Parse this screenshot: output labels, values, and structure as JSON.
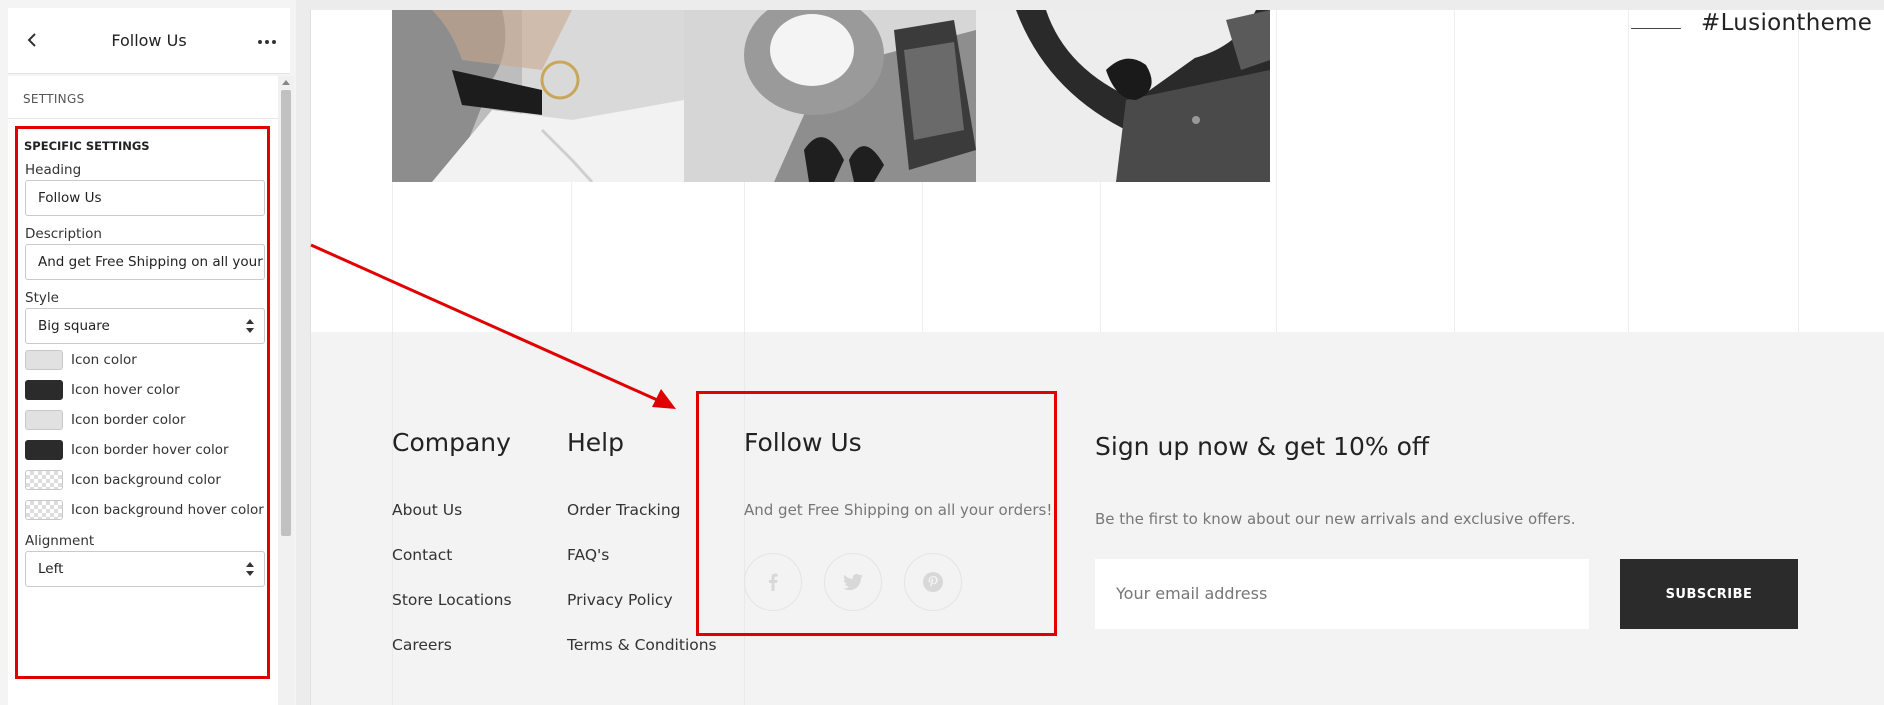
{
  "sidebar": {
    "title": "Follow Us",
    "section_label": "SETTINGS",
    "specific_settings_title": "SPECIFIC SETTINGS",
    "heading": {
      "label": "Heading",
      "value": "Follow Us"
    },
    "description": {
      "label": "Description",
      "value": "And get Free Shipping on all your orders!"
    },
    "style": {
      "label": "Style",
      "selected": "Big square"
    },
    "swatches": [
      {
        "label": "Icon color",
        "color": "#e1e1e1"
      },
      {
        "label": "Icon hover color",
        "color": "#2b2b2b"
      },
      {
        "label": "Icon border color",
        "color": "#e1e1e1"
      },
      {
        "label": "Icon border hover color",
        "color": "#2b2b2b"
      },
      {
        "label": "Icon background color",
        "color": "transparent"
      },
      {
        "label": "Icon background hover color",
        "color": "transparent"
      }
    ],
    "alignment": {
      "label": "Alignment",
      "selected": "Left"
    }
  },
  "preview": {
    "hashtag": "#Lusiontheme",
    "company": {
      "title": "Company",
      "links": [
        "About Us",
        "Contact",
        "Store Locations",
        "Careers"
      ]
    },
    "help": {
      "title": "Help",
      "links": [
        "Order Tracking",
        "FAQ's",
        "Privacy Policy",
        "Terms & Conditions"
      ]
    },
    "follow": {
      "title": "Follow Us",
      "description": "And get Free Shipping on all your orders!",
      "icons": [
        "facebook-icon",
        "twitter-icon",
        "pinterest-icon"
      ]
    },
    "signup": {
      "title": "Sign up now & get 10% off",
      "description": "Be the first to know about our new arrivals and exclusive offers.",
      "email_placeholder": "Your email address",
      "button": "SUBSCRIBE"
    }
  },
  "colors": {
    "annotation_red": "#e00000",
    "subscribe_bg": "#2b2b2b",
    "footer_bg": "#f3f3f3"
  }
}
